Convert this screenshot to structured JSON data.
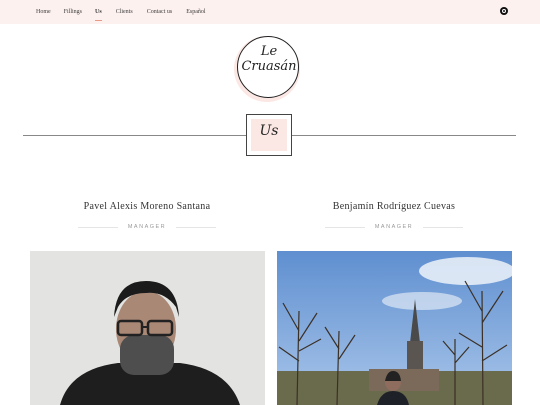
{
  "nav": {
    "items": [
      {
        "label": "Home",
        "active": false
      },
      {
        "label": "Fillings",
        "active": false
      },
      {
        "label": "Us",
        "active": true
      },
      {
        "label": "Clients",
        "active": false
      },
      {
        "label": "Contact us",
        "active": false
      },
      {
        "label": "Español",
        "active": false
      }
    ],
    "social_icon": "instagram-icon"
  },
  "logo": {
    "line1": "Le",
    "line2": "Cruasán"
  },
  "section": {
    "title": "Us"
  },
  "team": [
    {
      "name": "Pavel Alexis Moreno Santana",
      "role": "MANAGER"
    },
    {
      "name": "Benjamín Rodríguez Cuevas",
      "role": "MANAGER"
    }
  ],
  "colors": {
    "topbar_bg": "#fcf1ef",
    "accent": "#e99a86",
    "blush": "#fbe7e3"
  }
}
